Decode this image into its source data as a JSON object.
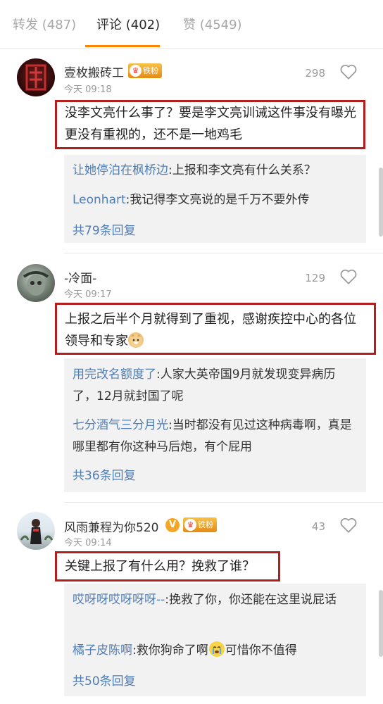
{
  "tabs": [
    {
      "label": "转发 (487)"
    },
    {
      "label": "评论 (402)"
    },
    {
      "label": "赞 (4549)"
    }
  ],
  "colors": {
    "accent": "#ff8200",
    "link": "#4f7db5",
    "highlight_box": "#b41e1e"
  },
  "comments": [
    {
      "username": "壹枚搬砖工",
      "badge": "铁粉",
      "time": "今天 09:18",
      "likes": "298",
      "text": "没李文亮什么事了？要是李文亮训诫这件事没有曝光更没有重视的，还不是一地鸡毛",
      "replies": [
        {
          "name": "让她停泊在枫桥边",
          "text": ":上报和李文亮有什么关系？"
        },
        {
          "name": "Leonhart",
          "text": ":我记得李文亮说的是千万不要外传"
        }
      ],
      "more": "共79条回复"
    },
    {
      "username": "-冷面-",
      "time": "今天 09:17",
      "likes": "129",
      "text": "上报之后半个月就得到了重视，感谢疾控中心的各位领导和专家",
      "emoji": "doge-emoji",
      "replies": [
        {
          "name": "用完改名额度了",
          "text": ":人家大英帝国9月就发现变异病历了，12月就封国了呢"
        },
        {
          "name": "七分酒气三分月光",
          "text": ":当时都没有见过这种病毒啊，真是哪里都有你这种马后炮，有个屁用"
        }
      ],
      "more": "共36条回复"
    },
    {
      "username": "风雨兼程为你520",
      "verified": "V",
      "badge": "铁粉",
      "time": "今天 09:14",
      "likes": "43",
      "text": "关键上报了有什么用？挽救了谁？",
      "replies": [
        {
          "name": "哎呀呀哎呀呀呀--",
          "text": ":挽救了你，你还能在这里说屁话"
        },
        {
          "name": "橘子皮陈啊",
          "text": ":救你狗命了啊",
          "text2": "可惜你不值得",
          "emoji": "crying-emoji"
        }
      ],
      "more": "共50条回复"
    }
  ]
}
